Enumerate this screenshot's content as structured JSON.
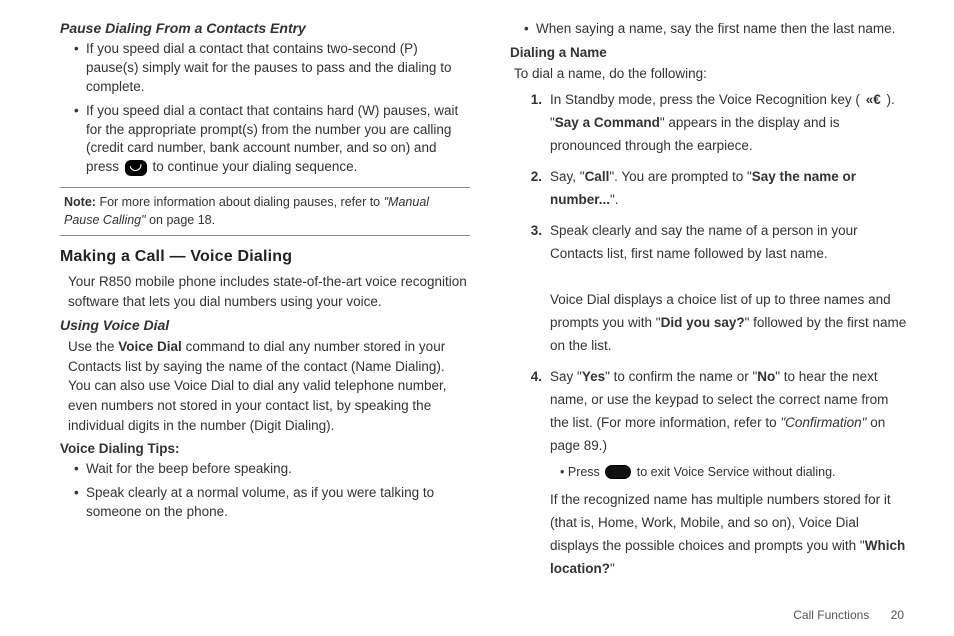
{
  "left": {
    "h1": "Pause Dialing From a Contacts Entry",
    "bullets1": [
      "If you speed dial a contact that contains two-second (P) pause(s) simply wait for the pauses to pass and the dialing to complete.",
      "If you speed dial a contact that contains hard (W) pauses, wait for the appropriate prompt(s) from the number you are calling (credit card number, bank account number, and so on) and press [END] to continue your dialing sequence."
    ],
    "note_label": "Note:",
    "note_text": "For more information about dialing pauses, refer to ",
    "note_ref": "\"Manual Pause Calling\"",
    "note_tail": " on page 18.",
    "h2": "Making a Call — Voice Dialing",
    "p2": "Your R850 mobile phone includes state-of-the-art voice recognition software that lets you dial numbers using your voice.",
    "h3": "Using Voice Dial",
    "p3_a": "Use the ",
    "p3_b": "Voice Dial",
    "p3_c": " command to dial any number stored in your Contacts list by saying the name of the contact (Name Dialing). You can also use Voice Dial to dial any valid telephone number, even numbers not stored in your contact list, by speaking the individual digits in the number (Digit Dialing).",
    "h4": "Voice Dialing Tips:",
    "bullets2": [
      "Wait for the beep before speaking.",
      "Speak clearly at a normal volume, as if you were talking to someone on the phone."
    ]
  },
  "right": {
    "top_bullet": "When saying a name, say the first name then the last name.",
    "h5": "Dialing a Name",
    "intro": "To dial a name, do the following:",
    "steps": [
      {
        "num": "1.",
        "parts": [
          "In Standby mode, press the Voice Recognition key ( ",
          "ICON_VOICE",
          " ). \"",
          "B:Say a Command",
          "\" appears in the display and is pronounced through the earpiece."
        ]
      },
      {
        "num": "2.",
        "parts": [
          "Say, \"",
          "B:Call",
          "\". You are prompted to \"",
          "B:Say the name or number...",
          "\"."
        ]
      },
      {
        "num": "3.",
        "parts": [
          "Speak clearly and say the name of a person in your Contacts list, first name followed by last name.",
          "BR",
          "Voice Dial displays a choice list of up to three names and prompts you with \"",
          "B:Did you say?",
          "\" followed by the first name on the list."
        ]
      },
      {
        "num": "4.",
        "parts": [
          "Say \"",
          "B:Yes",
          "\" to confirm the name or \"",
          "B:No",
          "\" to hear the next name, or use the keypad to select the correct name from the list. (For more information, refer to ",
          "I:\"Confirmation\"",
          " on page 89.)"
        ],
        "sub": [
          "Press ",
          "ICON_PILL",
          " to exit Voice Service without dialing."
        ],
        "tail": [
          "If the recognized name has multiple numbers stored for it (that is, Home, Work, Mobile, and so on), Voice Dial displays the possible choices and prompts you with \"",
          "B:Which location?",
          "\""
        ]
      }
    ]
  },
  "footer": {
    "section": "Call Functions",
    "page": "20"
  }
}
